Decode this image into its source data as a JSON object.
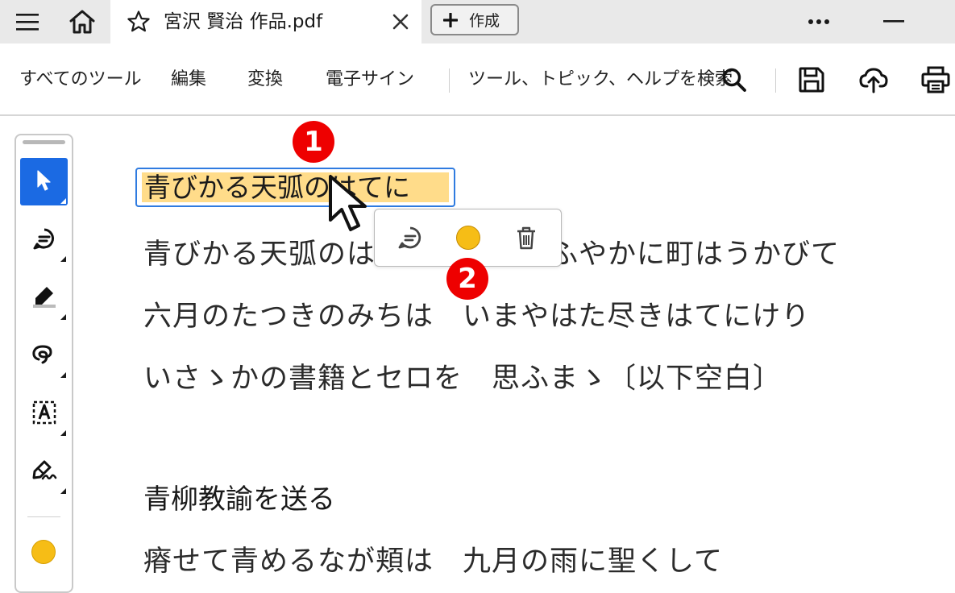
{
  "tabbar": {
    "menu_icon": "hamburger-menu-icon",
    "home_icon": "home-icon",
    "tab": {
      "star_icon": "star-icon",
      "title": "宮沢 賢治 作品.pdf",
      "close_icon": "close-icon"
    },
    "create_button": {
      "icon": "plus-icon",
      "label": "作成"
    },
    "more_icon": "more-horizontal-icon",
    "minimize_icon": "minimize-icon"
  },
  "toolbar": {
    "all_tools": "すべてのツール",
    "edit": "編集",
    "convert": "変換",
    "esign": "電子サイン",
    "search_label": "ツール、トピック、ヘルプを検索",
    "search_icon": "search-icon",
    "save_icon": "save-icon",
    "upload_icon": "cloud-upload-icon",
    "print_icon": "print-icon"
  },
  "left_panel": {
    "tools": [
      "select-cursor-icon",
      "add-comment-icon",
      "highlighter-icon",
      "freehand-draw-icon",
      "text-box-icon",
      "sign-pen-icon"
    ],
    "selected_tool": "select-cursor-icon",
    "current_color": "#f6bd16"
  },
  "document": {
    "title": "青びかる天弧のはてに",
    "lines": [
      "青びかる天弧のはてに　たゆたふやかに町はうかびて",
      "六月のたつきのみちは　いまやはた尽きはてにけり",
      "いさゝかの書籍とセロを　思ふまゝ〔以下空白〕"
    ],
    "heading2": "青柳教諭を送る",
    "line5": "瘠せて青めるなが頬は　九月の雨に聖くして"
  },
  "popup": {
    "comment_icon": "comment-icon",
    "color_icon": "color-swatch-icon",
    "color": "#f6bd16",
    "delete_icon": "trash-icon"
  },
  "annotations": {
    "badge1": "1",
    "badge2": "2"
  },
  "colors": {
    "accent": "#1b6ae3",
    "highlight": "#ffdc8a",
    "badge": "#ee0000"
  }
}
